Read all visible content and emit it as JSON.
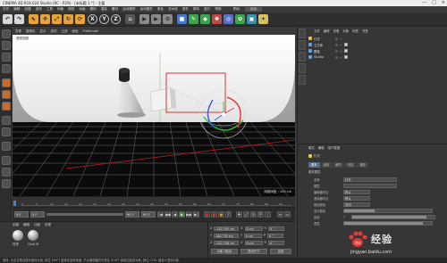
{
  "window": {
    "title": "CINEMA 4D R19.024 Studio (RC - R19) - [未标题 1 *] - 主要",
    "controls": [
      "—",
      "□",
      "×"
    ]
  },
  "menubar": {
    "items": [
      "文件",
      "编辑",
      "创建",
      "选择",
      "工具",
      "网格",
      "捕捉",
      "动画",
      "模拟",
      "渲染",
      "雕刻",
      "运动跟踪",
      "运动图形",
      "角色",
      "流水线",
      "插件",
      "脚本",
      "窗口",
      "帮助"
    ],
    "layout_label": "界面:",
    "layout_value": "启动"
  },
  "toolbar": {
    "axis_x": "X",
    "axis_y": "Y",
    "axis_z": "Z",
    "colors": {
      "accent_orange": "#e8a23a",
      "blue": "#4a78c8",
      "green": "#3fa34d",
      "red": "#c04848"
    }
  },
  "viewport": {
    "menu": [
      "查看",
      "摄像机",
      "显示",
      "选项",
      "过滤",
      "面板",
      "ProRender"
    ],
    "label": "透视视图",
    "status": "网格间距 : 100 cm",
    "colors": {
      "floor": "#0b0b0b",
      "grid": "#6f6f6f",
      "selection": "#e03030"
    }
  },
  "timeline": {
    "ticks": [
      "0",
      "5",
      "10",
      "15",
      "20",
      "25",
      "30",
      "35",
      "40",
      "45",
      "50",
      "55",
      "60",
      "65",
      "70",
      "75",
      "80",
      "85",
      "90"
    ],
    "end_label": "0 F"
  },
  "transport": {
    "current_frame": "0 F",
    "start_frame": "0 F",
    "end_frame": "90 F",
    "end_frame_2": "90 F",
    "buttons": [
      "|◀",
      "◀◀",
      "◀",
      "▶",
      "▶▶",
      "▶|",
      "●",
      "●",
      "●",
      "?"
    ]
  },
  "materials": {
    "menu": [
      "创建",
      "编辑",
      "功能",
      "纹理"
    ],
    "items": [
      "材质",
      "Gold M"
    ]
  },
  "coordinates": {
    "rows": [
      {
        "axis": "X",
        "pos": "-152.765 cm",
        "size": "0 cm",
        "rot_label": "H",
        "rot": "0 °"
      },
      {
        "axis": "Y",
        "pos": "100.739 cm",
        "size": "0 cm",
        "rot_label": "P",
        "rot": "0 °"
      },
      {
        "axis": "Z",
        "pos": "-232.336 cm",
        "size": "0 cm",
        "rot_label": "B",
        "rot": "0 °"
      }
    ],
    "mode_1": "对象 (相对)",
    "mode_2": "绝对尺寸",
    "apply": "应用"
  },
  "statusbar": {
    "text": "旋转: 点击并拖动鼠标旋转元素. 按住 SHIFT 键量化旋转角度; 节点编辑模式时按住 SHIFT 键增加选择对象; 按住 CTRL 键减少选择对象."
  },
  "objects": {
    "menu": [
      "文件",
      "编辑",
      "查看",
      "对象",
      "标签",
      "书签"
    ],
    "rows": [
      {
        "name": "灯光",
        "color": "#f0c040"
      },
      {
        "name": "立方体",
        "color": "#60a0e0"
      },
      {
        "name": "圆锥",
        "color": "#60a0e0"
      },
      {
        "name": "Studio",
        "color": "#60a0e0"
      }
    ]
  },
  "attributes": {
    "tabs": [
      "模式",
      "编辑",
      "用户数据"
    ],
    "header": "灯光",
    "section": "基本属性",
    "subtabs": [
      "基本",
      "坐标",
      "细节",
      "可见",
      "投影",
      "光度",
      "焦散",
      "噪波",
      "镜头光晕",
      "工程"
    ],
    "active_subtab": "基本",
    "rows": [
      {
        "label": "名称",
        "value": "灯光",
        "fill": 0
      },
      {
        "label": "图层",
        "value": "",
        "fill": 0
      },
      {
        "label": "编辑器可见",
        "value": "默认",
        "fill": 0
      },
      {
        "label": "渲染器可见",
        "value": "默认",
        "fill": 0
      },
      {
        "label": "使用颜色",
        "value": "关闭",
        "fill": 0
      },
      {
        "label": "显示颜色",
        "value": "",
        "fill": 0.35
      },
      {
        "label": "启用",
        "value": "✓",
        "fill": 0.9
      },
      {
        "label": "透显",
        "value": "",
        "fill": 0.9
      }
    ]
  },
  "watermark": {
    "line1": "经验",
    "line2": "jingyan.baidu.com"
  }
}
